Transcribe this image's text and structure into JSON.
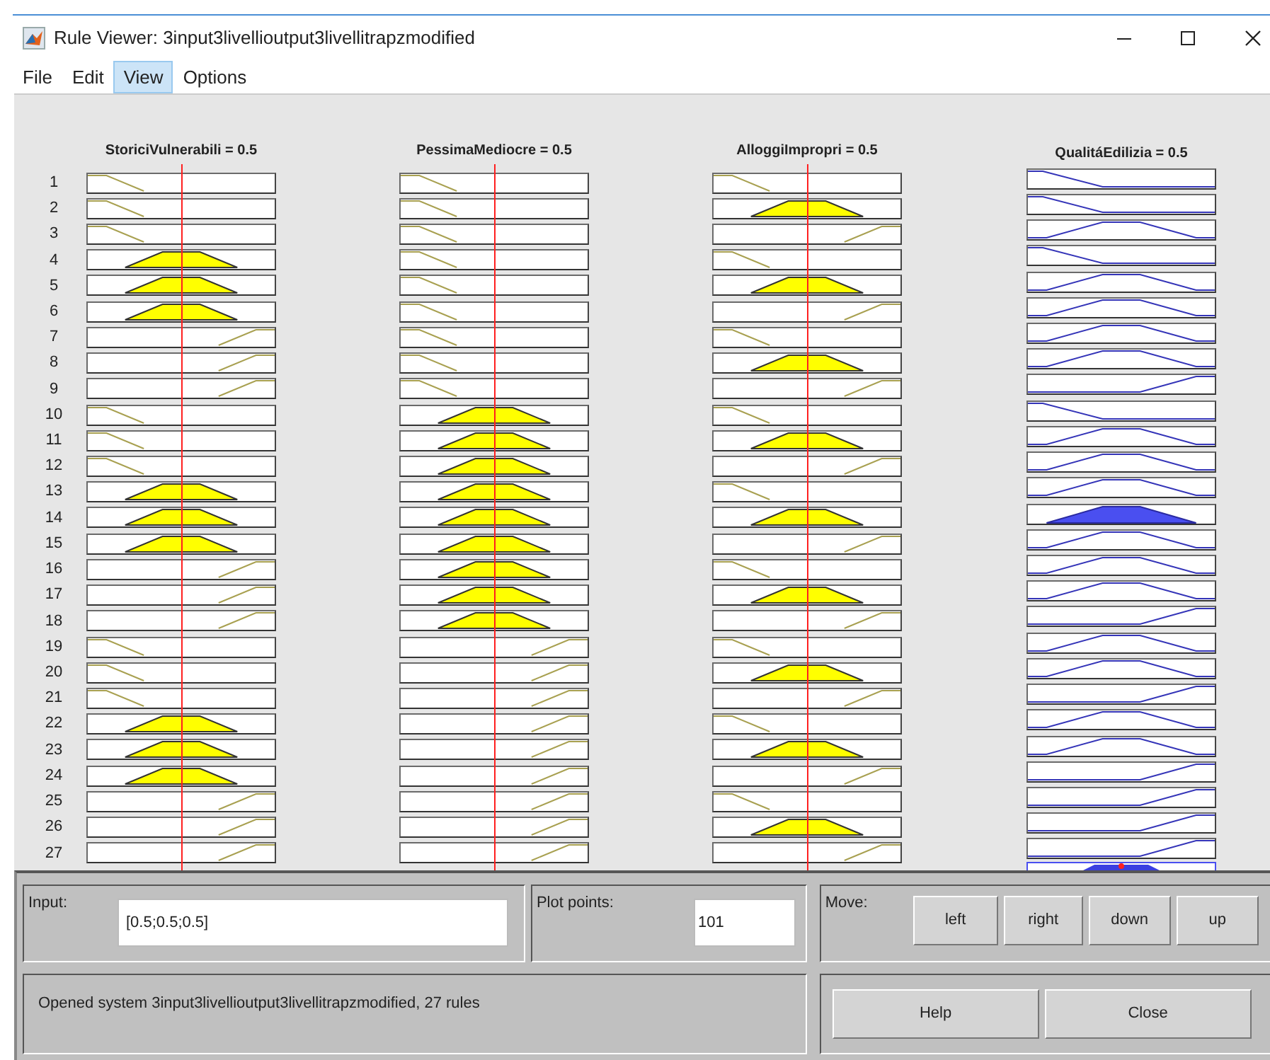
{
  "window": {
    "title": "Rule Viewer: 3input3livellioutput3livellitrapzmodified"
  },
  "menu": [
    {
      "label": "File",
      "selected": false
    },
    {
      "label": "Edit",
      "selected": false
    },
    {
      "label": "View",
      "selected": true
    },
    {
      "label": "Options",
      "selected": false
    }
  ],
  "inputs": [
    {
      "title": "StoriciVulnerabili = 0.5",
      "level": 0.5
    },
    {
      "title": "PessimaMediocre = 0.5",
      "level": 0.5
    },
    {
      "title": "AlloggiImpropri = 0.5",
      "level": 0.5
    }
  ],
  "output": {
    "title": "QualitáEdilizia = 0.5"
  },
  "rules": [
    {
      "number": "1",
      "mfs": [
        {
          "kind": "low",
          "filled": false
        },
        {
          "kind": "low",
          "filled": false
        },
        {
          "kind": "low",
          "filled": false
        }
      ],
      "output": {
        "kind": "low",
        "filled": false
      }
    },
    {
      "number": "2",
      "mfs": [
        {
          "kind": "low",
          "filled": false
        },
        {
          "kind": "low",
          "filled": false
        },
        {
          "kind": "medium",
          "filled": true
        }
      ],
      "output": {
        "kind": "low",
        "filled": false
      }
    },
    {
      "number": "3",
      "mfs": [
        {
          "kind": "low",
          "filled": false
        },
        {
          "kind": "low",
          "filled": false
        },
        {
          "kind": "high",
          "filled": false
        }
      ],
      "output": {
        "kind": "medium",
        "filled": false
      }
    },
    {
      "number": "4",
      "mfs": [
        {
          "kind": "medium",
          "filled": true
        },
        {
          "kind": "low",
          "filled": false
        },
        {
          "kind": "low",
          "filled": false
        }
      ],
      "output": {
        "kind": "low",
        "filled": false
      }
    },
    {
      "number": "5",
      "mfs": [
        {
          "kind": "medium",
          "filled": true
        },
        {
          "kind": "low",
          "filled": false
        },
        {
          "kind": "medium",
          "filled": true
        }
      ],
      "output": {
        "kind": "medium",
        "filled": false
      }
    },
    {
      "number": "6",
      "mfs": [
        {
          "kind": "medium",
          "filled": true
        },
        {
          "kind": "low",
          "filled": false
        },
        {
          "kind": "high",
          "filled": false
        }
      ],
      "output": {
        "kind": "medium",
        "filled": false
      }
    },
    {
      "number": "7",
      "mfs": [
        {
          "kind": "high",
          "filled": false
        },
        {
          "kind": "low",
          "filled": false
        },
        {
          "kind": "low",
          "filled": false
        }
      ],
      "output": {
        "kind": "medium",
        "filled": false
      }
    },
    {
      "number": "8",
      "mfs": [
        {
          "kind": "high",
          "filled": false
        },
        {
          "kind": "low",
          "filled": false
        },
        {
          "kind": "medium",
          "filled": true
        }
      ],
      "output": {
        "kind": "medium",
        "filled": false
      }
    },
    {
      "number": "9",
      "mfs": [
        {
          "kind": "high",
          "filled": false
        },
        {
          "kind": "low",
          "filled": false
        },
        {
          "kind": "high",
          "filled": false
        }
      ],
      "output": {
        "kind": "high",
        "filled": false
      }
    },
    {
      "number": "10",
      "mfs": [
        {
          "kind": "low",
          "filled": false
        },
        {
          "kind": "medium",
          "filled": true
        },
        {
          "kind": "low",
          "filled": false
        }
      ],
      "output": {
        "kind": "low",
        "filled": false
      }
    },
    {
      "number": "11",
      "mfs": [
        {
          "kind": "low",
          "filled": false
        },
        {
          "kind": "medium",
          "filled": true
        },
        {
          "kind": "medium",
          "filled": true
        }
      ],
      "output": {
        "kind": "medium",
        "filled": false
      }
    },
    {
      "number": "12",
      "mfs": [
        {
          "kind": "low",
          "filled": false
        },
        {
          "kind": "medium",
          "filled": true
        },
        {
          "kind": "high",
          "filled": false
        }
      ],
      "output": {
        "kind": "medium",
        "filled": false
      }
    },
    {
      "number": "13",
      "mfs": [
        {
          "kind": "medium",
          "filled": true
        },
        {
          "kind": "medium",
          "filled": true
        },
        {
          "kind": "low",
          "filled": false
        }
      ],
      "output": {
        "kind": "medium",
        "filled": false
      }
    },
    {
      "number": "14",
      "mfs": [
        {
          "kind": "medium",
          "filled": true
        },
        {
          "kind": "medium",
          "filled": true
        },
        {
          "kind": "medium",
          "filled": true
        }
      ],
      "output": {
        "kind": "medium",
        "filled": true
      }
    },
    {
      "number": "15",
      "mfs": [
        {
          "kind": "medium",
          "filled": true
        },
        {
          "kind": "medium",
          "filled": true
        },
        {
          "kind": "high",
          "filled": false
        }
      ],
      "output": {
        "kind": "medium",
        "filled": false
      }
    },
    {
      "number": "16",
      "mfs": [
        {
          "kind": "high",
          "filled": false
        },
        {
          "kind": "medium",
          "filled": true
        },
        {
          "kind": "low",
          "filled": false
        }
      ],
      "output": {
        "kind": "medium",
        "filled": false
      }
    },
    {
      "number": "17",
      "mfs": [
        {
          "kind": "high",
          "filled": false
        },
        {
          "kind": "medium",
          "filled": true
        },
        {
          "kind": "medium",
          "filled": true
        }
      ],
      "output": {
        "kind": "medium",
        "filled": false
      }
    },
    {
      "number": "18",
      "mfs": [
        {
          "kind": "high",
          "filled": false
        },
        {
          "kind": "medium",
          "filled": true
        },
        {
          "kind": "high",
          "filled": false
        }
      ],
      "output": {
        "kind": "high",
        "filled": false
      }
    },
    {
      "number": "19",
      "mfs": [
        {
          "kind": "low",
          "filled": false
        },
        {
          "kind": "high",
          "filled": false
        },
        {
          "kind": "low",
          "filled": false
        }
      ],
      "output": {
        "kind": "medium",
        "filled": false
      }
    },
    {
      "number": "20",
      "mfs": [
        {
          "kind": "low",
          "filled": false
        },
        {
          "kind": "high",
          "filled": false
        },
        {
          "kind": "medium",
          "filled": true
        }
      ],
      "output": {
        "kind": "medium",
        "filled": false
      }
    },
    {
      "number": "21",
      "mfs": [
        {
          "kind": "low",
          "filled": false
        },
        {
          "kind": "high",
          "filled": false
        },
        {
          "kind": "high",
          "filled": false
        }
      ],
      "output": {
        "kind": "high",
        "filled": false
      }
    },
    {
      "number": "22",
      "mfs": [
        {
          "kind": "medium",
          "filled": true
        },
        {
          "kind": "high",
          "filled": false
        },
        {
          "kind": "low",
          "filled": false
        }
      ],
      "output": {
        "kind": "medium",
        "filled": false
      }
    },
    {
      "number": "23",
      "mfs": [
        {
          "kind": "medium",
          "filled": true
        },
        {
          "kind": "high",
          "filled": false
        },
        {
          "kind": "medium",
          "filled": true
        }
      ],
      "output": {
        "kind": "medium",
        "filled": false
      }
    },
    {
      "number": "24",
      "mfs": [
        {
          "kind": "medium",
          "filled": true
        },
        {
          "kind": "high",
          "filled": false
        },
        {
          "kind": "high",
          "filled": false
        }
      ],
      "output": {
        "kind": "high",
        "filled": false
      }
    },
    {
      "number": "25",
      "mfs": [
        {
          "kind": "high",
          "filled": false
        },
        {
          "kind": "high",
          "filled": false
        },
        {
          "kind": "low",
          "filled": false
        }
      ],
      "output": {
        "kind": "high",
        "filled": false
      }
    },
    {
      "number": "26",
      "mfs": [
        {
          "kind": "high",
          "filled": false
        },
        {
          "kind": "high",
          "filled": false
        },
        {
          "kind": "medium",
          "filled": true
        }
      ],
      "output": {
        "kind": "high",
        "filled": false
      }
    },
    {
      "number": "27",
      "mfs": [
        {
          "kind": "high",
          "filled": false
        },
        {
          "kind": "high",
          "filled": false
        },
        {
          "kind": "high",
          "filled": false
        }
      ],
      "output": {
        "kind": "high",
        "filled": false
      }
    }
  ],
  "input_panel": {
    "label": "Input:",
    "value": "[0.5;0.5;0.5]"
  },
  "plot_points": {
    "label": "Plot points:",
    "value": "101"
  },
  "move": {
    "label": "Move:",
    "buttons": [
      "left",
      "right",
      "down",
      "up"
    ]
  },
  "status": "Opened system 3input3livellioutput3livellitrapzmodified, 27 rules",
  "buttons": [
    "Help",
    "Close"
  ]
}
